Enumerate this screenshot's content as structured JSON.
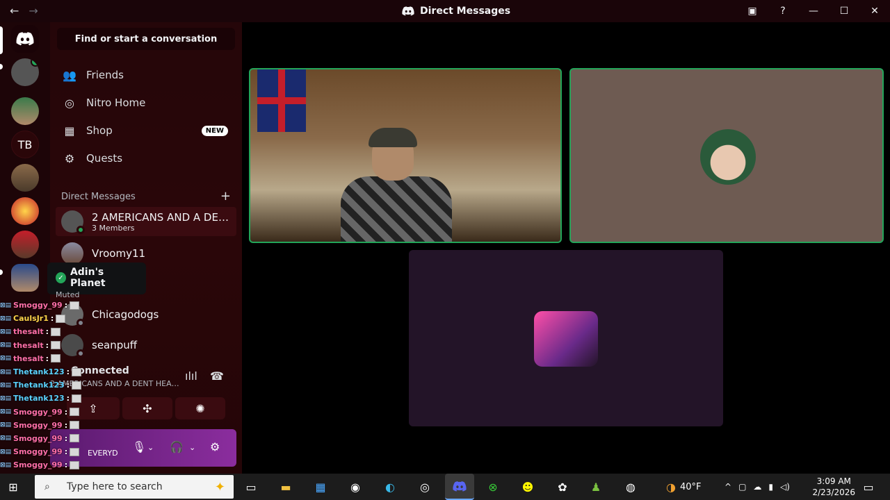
{
  "window": {
    "title": "Direct Messages",
    "back_icon": "←",
    "forward_icon": "→"
  },
  "servers": {
    "tb_label": "TB"
  },
  "sidebar": {
    "find_label": "Find or start a conversation",
    "nav": [
      {
        "label": "Friends",
        "icon": "friends-icon"
      },
      {
        "label": "Nitro Home",
        "icon": "nitro-icon"
      },
      {
        "label": "Shop",
        "icon": "shop-icon",
        "badge": "NEW"
      },
      {
        "label": "Quests",
        "icon": "quests-icon"
      }
    ],
    "dm_header": "Direct Messages",
    "dm_add": "+",
    "dms": [
      {
        "name": "2 AMERICANS AND A DEN...",
        "sub": "3 Members"
      },
      {
        "name": "Vroomy11"
      },
      {
        "name": "Chicagodogs"
      },
      {
        "name": "seanpuff"
      }
    ]
  },
  "tooltip": {
    "title": "Adin's Planet",
    "status": "Muted"
  },
  "voice": {
    "status": "Connected",
    "channel": "2 AMERICANS AND A DENT HEAD..."
  },
  "user": {
    "status_text": "EVERYD"
  },
  "chat_overlay": [
    {
      "user": "Smoggy_99",
      "color": "#ff6fa8"
    },
    {
      "user": "CaulsJr1",
      "color": "#ffd54a"
    },
    {
      "user": "thesalt",
      "color": "#ff6fa8"
    },
    {
      "user": "thesalt",
      "color": "#ff6fa8"
    },
    {
      "user": "thesalt",
      "color": "#ff6fa8"
    },
    {
      "user": "Thetank123",
      "color": "#5bd2ff"
    },
    {
      "user": "Thetank123",
      "color": "#5bd2ff"
    },
    {
      "user": "Thetank123",
      "color": "#5bd2ff"
    },
    {
      "user": "Smoggy_99",
      "color": "#ff6fa8"
    },
    {
      "user": "Smoggy_99",
      "color": "#ff6fa8"
    },
    {
      "user": "Smoggy_99",
      "color": "#ff6fa8"
    },
    {
      "user": "Smoggy_99",
      "color": "#ff6fa8"
    },
    {
      "user": "Smoggy_99",
      "color": "#ff6fa8"
    },
    {
      "user": "Smoggy_99",
      "color": "#ff6fa8"
    },
    {
      "user": "thesalt",
      "color": "#ff6fa8"
    }
  ],
  "taskbar": {
    "search_placeholder": "Type here to search",
    "weather": "40°F",
    "time": "3:09 AM",
    "date": "2/23/2026"
  },
  "colors": {
    "speaking_border": "#23a559",
    "online": "#23a559"
  }
}
